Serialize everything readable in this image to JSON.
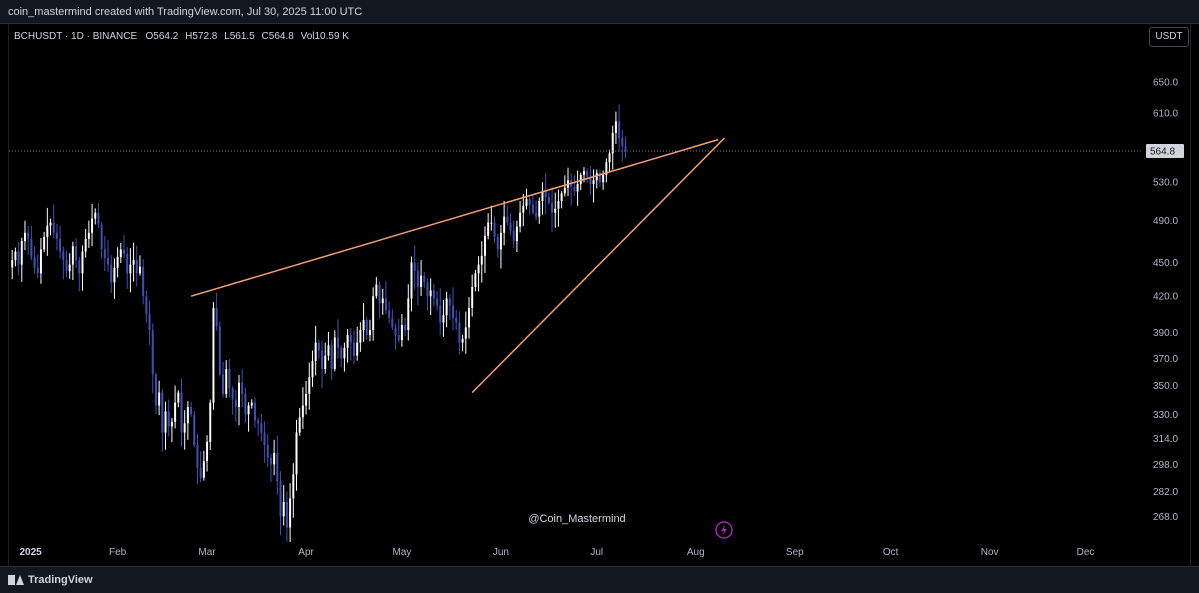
{
  "header": {
    "caption": "coin_mastermind created with TradingView.com, Jul 30, 2025 11:00 UTC"
  },
  "legend": {
    "symbol": "BCHUSDT · 1D · BINANCE",
    "open_key": "O",
    "open": "564.2",
    "high_key": "H",
    "high": "572.8",
    "low_key": "L",
    "low": "561.5",
    "close_key": "C",
    "close": "564.8",
    "vol_key": "Vol",
    "vol": "10.59 K"
  },
  "currency_button": "USDT",
  "watermark": "@Coin_Mastermind",
  "branding": {
    "logo_text": "TradingView"
  },
  "colors": {
    "up": "#ffffff",
    "down": "#3f51b5",
    "trendline": "#f0a070",
    "price_line": "#757575",
    "bolt": "#9c27b0"
  },
  "icons": {
    "alert": "lightning-bolt-icon"
  },
  "chart_data": {
    "type": "candlestick",
    "scale": "log",
    "ylim": [
      258,
      680
    ],
    "current_price": "564.8",
    "y_ticks": [
      "650.0",
      "610.0",
      "530.0",
      "490.0",
      "450.0",
      "420.0",
      "390.0",
      "370.0",
      "350.0",
      "330.0",
      "314.0",
      "298.0",
      "282.0",
      "268.0"
    ],
    "x_labels": [
      {
        "label": "2025",
        "date": "2025-01-01",
        "bold": true
      },
      {
        "label": "Feb",
        "date": "2025-02-01"
      },
      {
        "label": "Mar",
        "date": "2025-03-01"
      },
      {
        "label": "Apr",
        "date": "2025-04-01"
      },
      {
        "label": "May",
        "date": "2025-05-01"
      },
      {
        "label": "Jun",
        "date": "2025-06-01"
      },
      {
        "label": "Jul",
        "date": "2025-07-01"
      },
      {
        "label": "Aug",
        "date": "2025-08-01"
      },
      {
        "label": "Sep",
        "date": "2025-09-01"
      },
      {
        "label": "Oct",
        "date": "2025-10-01"
      },
      {
        "label": "Nov",
        "date": "2025-11-01"
      },
      {
        "label": "Dec",
        "date": "2025-12-01"
      }
    ],
    "x_start": "2024-12-29",
    "x_end": "2025-12-19",
    "trendlines": [
      {
        "name": "upper-resistance",
        "from": {
          "date": "2025-02-24",
          "price": 420
        },
        "to": {
          "date": "2025-08-08",
          "price": 578
        }
      },
      {
        "name": "lower-support",
        "from": {
          "date": "2025-05-23",
          "price": 345
        },
        "to": {
          "date": "2025-08-10",
          "price": 580
        }
      }
    ],
    "closes": [
      452,
      460,
      448,
      470,
      478,
      472,
      455,
      445,
      440,
      462,
      474,
      485,
      488,
      478,
      472,
      460,
      452,
      442,
      448,
      465,
      452,
      440,
      460,
      472,
      478,
      492,
      498,
      486,
      462,
      454,
      448,
      432,
      445,
      455,
      462,
      458,
      440,
      448,
      452,
      440,
      446,
      420,
      405,
      392,
      358,
      336,
      345,
      318,
      332,
      322,
      325,
      338,
      345,
      318,
      324,
      335,
      330,
      310,
      296,
      290,
      300,
      312,
      338,
      410,
      395,
      358,
      344,
      362,
      348,
      340,
      335,
      352,
      344,
      330,
      336,
      338,
      326,
      324,
      318,
      310,
      302,
      298,
      305,
      288,
      268,
      276,
      262,
      278,
      292,
      318,
      328,
      336,
      344,
      356,
      368,
      382,
      376,
      362,
      372,
      380,
      362,
      386,
      378,
      370,
      378,
      388,
      382,
      372,
      382,
      392,
      400,
      388,
      392,
      420,
      430,
      414,
      418,
      408,
      402,
      394,
      388,
      384,
      396,
      392,
      418,
      450,
      442,
      428,
      438,
      432,
      420,
      425,
      418,
      412,
      398,
      404,
      418,
      412,
      402,
      398,
      382,
      385,
      394,
      410,
      428,
      440,
      448,
      456,
      475,
      488,
      488,
      474,
      462,
      478,
      494,
      488,
      480,
      470,
      484,
      498,
      505,
      512,
      506,
      498,
      494,
      510,
      520,
      514,
      508,
      498,
      502,
      510,
      518,
      524,
      532,
      525,
      520,
      528,
      538,
      542,
      536,
      528,
      532,
      540,
      530,
      538,
      552,
      562,
      586,
      600,
      580,
      570,
      564
    ]
  }
}
